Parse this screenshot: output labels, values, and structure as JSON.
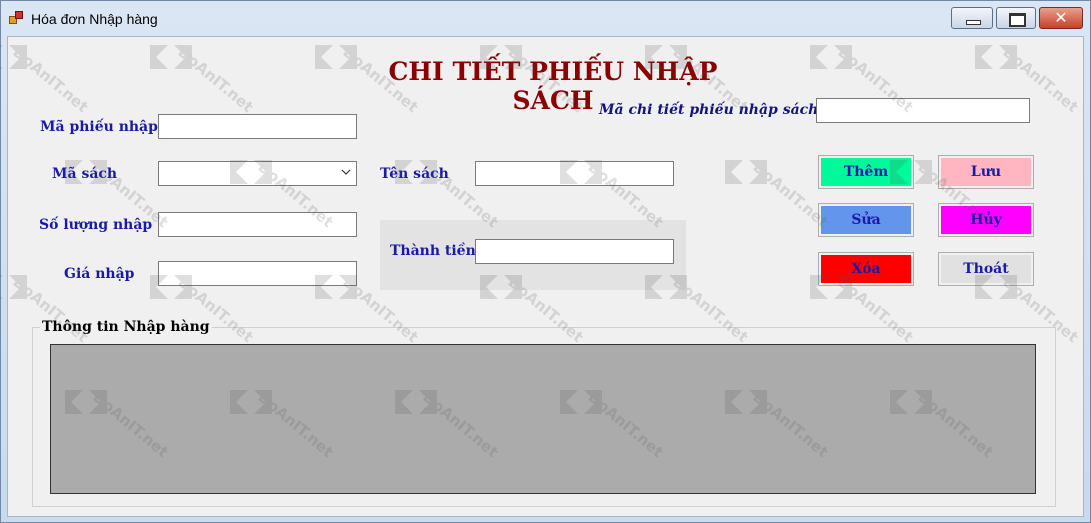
{
  "window": {
    "title": "Hóa đơn Nhập hàng",
    "close_glyph": "✕"
  },
  "form": {
    "heading": "CHI TIẾT PHIẾU NHẬP SÁCH",
    "labels": {
      "ma_chi_tiet": "Mã chi tiết phiếu nhập sách:",
      "ma_phieu_nhap": "Mã phiếu nhập",
      "ma_sach": "Mã sách",
      "ten_sach": "Tên sách",
      "so_luong_nhap": "Số lượng nhập",
      "thanh_tien": "Thành tiền",
      "gia_nhap": "Giá nhập"
    },
    "values": {
      "ma_chi_tiet": "",
      "ma_phieu_nhap": "",
      "ma_sach": "",
      "ten_sach": "",
      "so_luong_nhap": "",
      "thanh_tien": "",
      "gia_nhap": ""
    }
  },
  "buttons": {
    "them": {
      "label": "Thêm",
      "color": "#00fa9a"
    },
    "luu": {
      "label": "Lưu",
      "color": "#ffb6c1"
    },
    "sua": {
      "label": "Sửa",
      "color": "#6495ed"
    },
    "huy": {
      "label": "Hủy",
      "color": "#ff00ff"
    },
    "xoa": {
      "label": "Xóa",
      "color": "#ff0000"
    },
    "thoat": {
      "label": "Thoát",
      "color": "#e1e1e1"
    }
  },
  "group": {
    "title": "Thông tin Nhập hàng"
  },
  "colors": {
    "heading": "#8b0000",
    "label": "#1a1aa6",
    "grid_background": "#ababab"
  },
  "watermark": {
    "text": "DoAnIT.net"
  }
}
